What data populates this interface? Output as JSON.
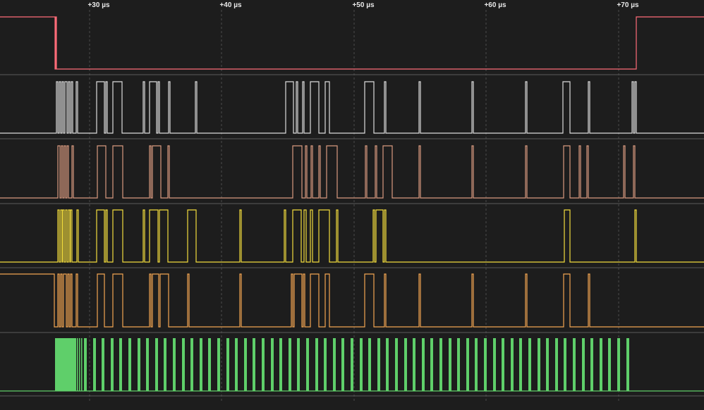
{
  "timeline": {
    "ticks": [
      "+30 µs",
      "+40 µs",
      "+50 µs",
      "+60 µs",
      "+70 µs"
    ]
  },
  "colors": {
    "background": "#1d1d1d",
    "separator": "#5a5a5a",
    "grid": "#4a4a4a",
    "channels": [
      "#ff6b78",
      "#dcdcdc",
      "#d99a80",
      "#f2dc3c",
      "#f2a552",
      "#5fcf6a"
    ]
  },
  "channels": [
    {
      "id": "ch1",
      "color_index": 0,
      "edges": [
        [
          0,
          1
        ],
        [
          78,
          0
        ],
        [
          79,
          1
        ],
        [
          80,
          0
        ],
        [
          902,
          1
        ]
      ]
    },
    {
      "id": "ch2",
      "color_index": 1,
      "edges": "dense"
    },
    {
      "id": "ch3",
      "color_index": 2,
      "edges": "dense"
    },
    {
      "id": "ch4",
      "color_index": 3,
      "edges": "dense"
    },
    {
      "id": "ch5",
      "color_index": 4,
      "edges": "dense"
    },
    {
      "id": "ch6",
      "color_index": 5,
      "edges": "clock"
    }
  ]
}
